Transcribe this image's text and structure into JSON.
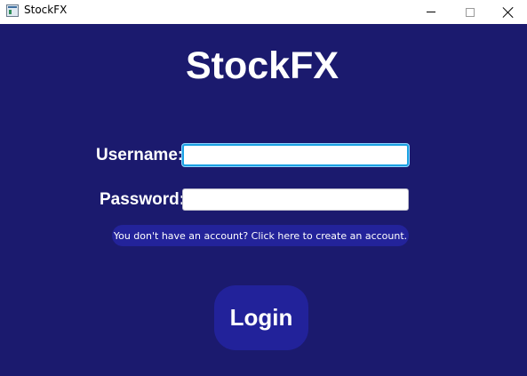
{
  "window": {
    "title": "StockFX",
    "controls": [
      "minimize-icon",
      "maximize-icon",
      "close-icon"
    ]
  },
  "main": {
    "app_title": "StockFX",
    "username_label": "Username:",
    "username_value": "",
    "password_label": "Password:",
    "password_value": "",
    "signup_link": "You don't have an account? Click here to create an account.",
    "login_button": "Login"
  },
  "colors": {
    "background": "#1b1a6e",
    "button": "#22229a",
    "focus_border": "#1ba1e2"
  }
}
